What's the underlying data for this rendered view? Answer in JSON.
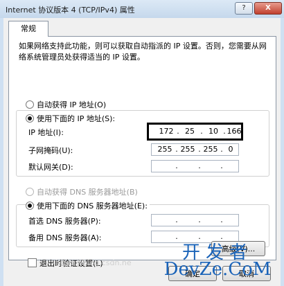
{
  "window": {
    "title": "Internet 协议版本 4 (TCP/IPv4) 属性",
    "help_button": "?",
    "close_button": "X"
  },
  "tab": {
    "label": "常规"
  },
  "description": "如果网络支持此功能，则可以获取自动指派的 IP 设置。否则，您需要从网络系统管理员处获得适当的 IP 设置。",
  "ip_section": {
    "auto_label": "自动获得 IP 地址(O)",
    "manual_label": "使用下面的 IP 地址(S):",
    "selected": "manual",
    "fields": [
      {
        "label": "IP 地址(I):",
        "octets": [
          "172",
          "25",
          "10",
          "166"
        ],
        "highlighted": true
      },
      {
        "label": "子网掩码(U):",
        "octets": [
          "255",
          "255",
          "255",
          "0"
        ]
      },
      {
        "label": "默认网关(D):",
        "octets": [
          "",
          "",
          "",
          ""
        ]
      }
    ]
  },
  "dns_section": {
    "auto_label": "自动获得 DNS 服务器地址(B)",
    "manual_label": "使用下面的 DNS 服务器地址(E):",
    "selected": "manual",
    "fields": [
      {
        "label": "首选 DNS 服务器(P):",
        "octets": [
          "",
          "",
          "",
          ""
        ]
      },
      {
        "label": "备用 DNS 服务器(A):",
        "octets": [
          "",
          "",
          "",
          ""
        ]
      }
    ]
  },
  "validate_checkbox": {
    "label": "退出时验证设置(L)",
    "checked": false
  },
  "buttons": {
    "advanced": "高级(V)...",
    "ok": "确定",
    "cancel": "取消"
  },
  "watermark": {
    "line1": "开发者",
    "line2": "DevZe.CoM",
    "blog_url": "https://blog.csdn.ne"
  },
  "colors": {
    "window_frame": "#cfe0f2",
    "dialog_bg": "#f0f0f0",
    "watermark": "#1a63b8",
    "highlight_border": "#000000"
  }
}
